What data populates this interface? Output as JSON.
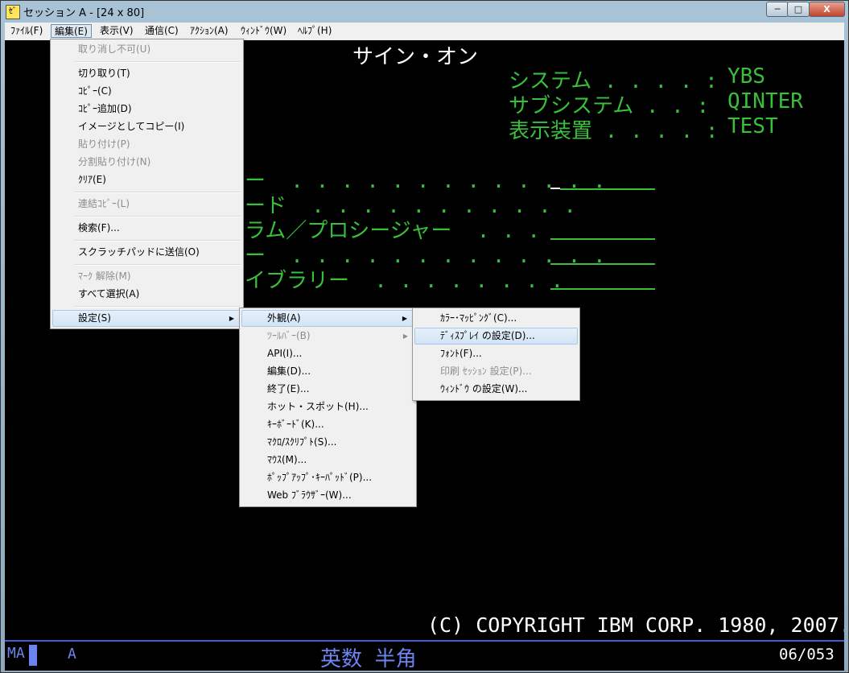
{
  "window": {
    "title": "セッション A - [24 x 80]",
    "icon_label": "ｾﾞ",
    "controls": {
      "minimize": "─",
      "maximize": "□",
      "close": "X"
    }
  },
  "menubar": [
    "ﾌｧｲﾙ(F)",
    "編集(E)",
    "表示(V)",
    "通信(C)",
    "ｱｸｼｮﾝ(A)",
    "ｳｨﾝﾄﾞｳ(W)",
    "ﾍﾙﾌﾟ(H)"
  ],
  "screen": {
    "title": "サイン・オン",
    "info": [
      {
        "label": "システム . . . . :",
        "value": "YBS"
      },
      {
        "label": "サブシステム . . :",
        "value": "QINTER"
      },
      {
        "label": "表示装置 . . . . :",
        "value": "TEST"
      }
    ],
    "field_fragments": [
      "ー  . . . . . . . . . . . . .",
      "ード  . . . . . . . . . . .",
      "ラム／プロシージャー  . . .",
      "ー  . . . . . . . . . . . . .",
      "イブラリー  . . . . . . . ."
    ],
    "copyright": "(C) COPYRIGHT IBM CORP. 1980, 2007."
  },
  "statusbar": {
    "mode": "MA",
    "session": "A",
    "input_mode": "英数 半角",
    "cursor_pos": "06/053"
  },
  "edit_menu": {
    "items": [
      {
        "label": "取り消し不可(U)",
        "disabled": true
      },
      {
        "separator": true
      },
      {
        "label": "切り取り(T)"
      },
      {
        "label": "ｺﾋﾟｰ(C)"
      },
      {
        "label": "ｺﾋﾟｰ追加(D)"
      },
      {
        "label": "イメージとしてコピー(I)"
      },
      {
        "label": "貼り付け(P)",
        "disabled": true
      },
      {
        "label": "分割貼り付け(N)",
        "disabled": true
      },
      {
        "label": "ｸﾘｱ(E)"
      },
      {
        "separator": true
      },
      {
        "label": "連結ｺﾋﾟｰ(L)",
        "disabled": true
      },
      {
        "separator": true
      },
      {
        "label": "検索(F)..."
      },
      {
        "separator": true
      },
      {
        "label": "スクラッチパッドに送信(O)"
      },
      {
        "separator": true
      },
      {
        "label": "ﾏｰｸ 解除(M)",
        "disabled": true
      },
      {
        "label": "すべて選択(A)"
      },
      {
        "separator": true
      },
      {
        "label": "設定(S)",
        "submenu": true,
        "highlight": true
      }
    ]
  },
  "settings_menu": {
    "items": [
      {
        "label": "外観(A)",
        "submenu": true,
        "highlight": true
      },
      {
        "label": "ﾂｰﾙﾊﾞｰ(B)",
        "submenu": true,
        "disabled": true
      },
      {
        "label": "API(I)..."
      },
      {
        "label": "編集(D)..."
      },
      {
        "label": "終了(E)..."
      },
      {
        "label": "ホット・スポット(H)..."
      },
      {
        "label": "ｷｰﾎﾞｰﾄﾞ(K)..."
      },
      {
        "label": "ﾏｸﾛ/ｽｸﾘﾌﾟﾄ(S)..."
      },
      {
        "label": "ﾏｳｽ(M)..."
      },
      {
        "label": "ﾎﾟｯﾌﾟｱｯﾌﾟ･ｷｰﾊﾟｯﾄﾞ(P)..."
      },
      {
        "label": "Web ﾌﾞﾗｳｻﾞｰ(W)..."
      }
    ]
  },
  "appearance_menu": {
    "items": [
      {
        "label": "ｶﾗｰ･ﾏｯﾋﾟﾝｸﾞ(C)..."
      },
      {
        "label": "ﾃﾞｨｽﾌﾟﾚｲ の設定(D)...",
        "highlight": true
      },
      {
        "label": "ﾌｫﾝﾄ(F)..."
      },
      {
        "label": "印刷 ｾｯｼｮﾝ 設定(P)...",
        "disabled": true
      },
      {
        "label": "ｳｨﾝﾄﾞｳ の設定(W)..."
      }
    ]
  },
  "colors": {
    "screen_green": "#39c03b",
    "screen_white": "#ffffff",
    "status_blue": "#6b84f0"
  }
}
